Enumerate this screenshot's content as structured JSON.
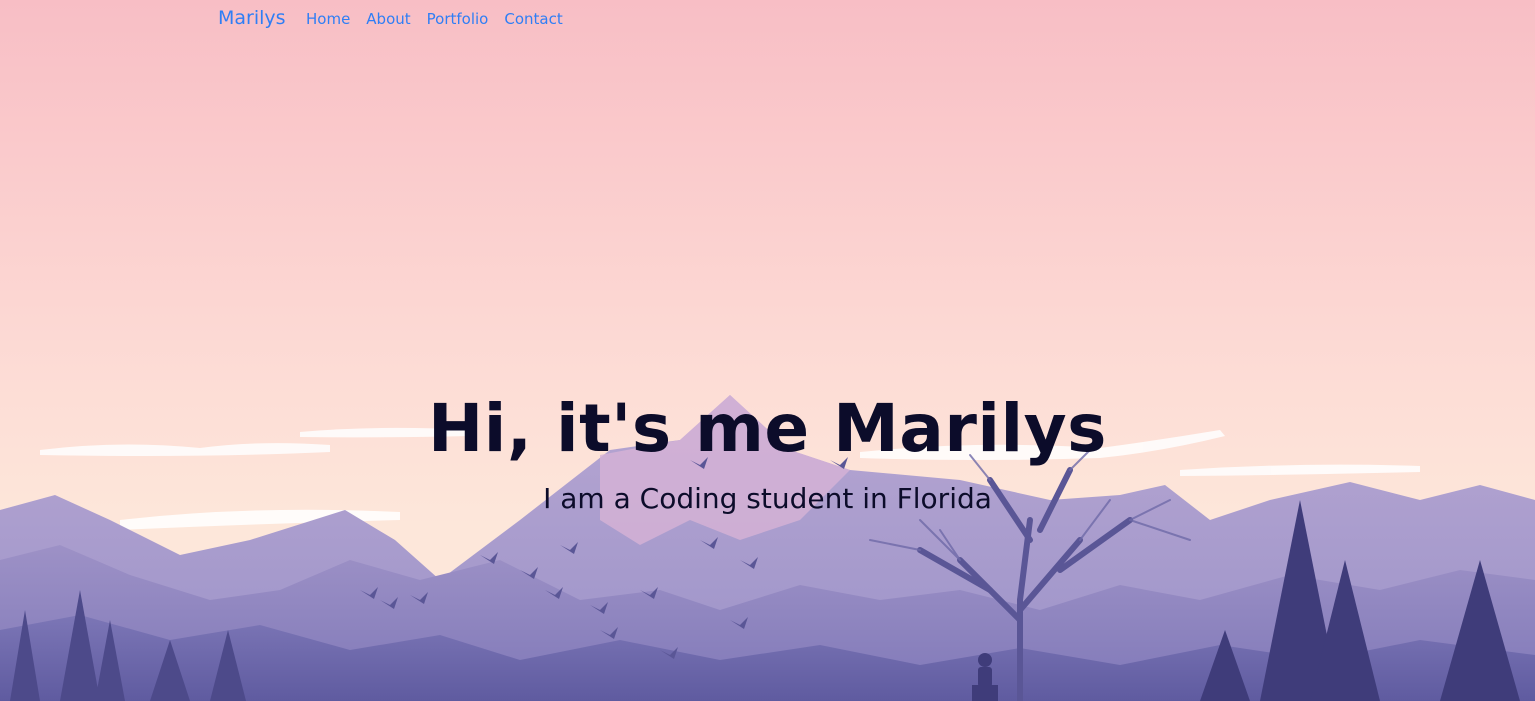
{
  "navbar": {
    "brand": "Marilys",
    "links": [
      {
        "label": "Home"
      },
      {
        "label": "About"
      },
      {
        "label": "Portfolio"
      },
      {
        "label": "Contact"
      }
    ]
  },
  "hero": {
    "title": "Hi, it's me Marilys",
    "subtitle": "I am a Coding student in Florida",
    "background": "mountain-landscape-illustration"
  },
  "colors": {
    "link": "#2f7ef5",
    "heading": "#0c0c2a",
    "sky_top": "#f9c0c6",
    "sky_bottom": "#fde2d6",
    "mountain_far": "#a89ccb",
    "mountain_near": "#6e6aa8"
  }
}
